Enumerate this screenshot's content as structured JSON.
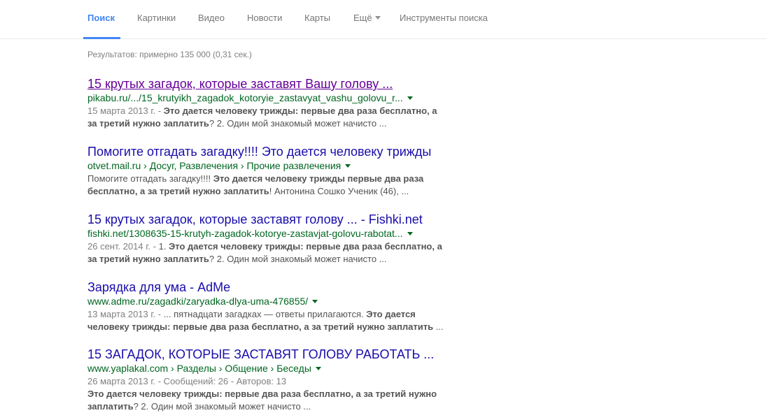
{
  "tabs": [
    {
      "label": "Поиск",
      "active": true
    },
    {
      "label": "Картинки"
    },
    {
      "label": "Видео"
    },
    {
      "label": "Новости"
    },
    {
      "label": "Карты"
    },
    {
      "label": "Ещё"
    },
    {
      "label": "Инструменты поиска"
    }
  ],
  "stats": "Результатов: примерно 135 000 (0,31 сек.) ",
  "results": [
    {
      "title": "15 крутых загадок, которые заставят Вашу голову ...",
      "visited": true,
      "url": "pikabu.ru/.../15_krutyikh_zagadok_kotoryie_zastavyat_vashu_golovu_r...",
      "line1": [
        {
          "t": "15 марта 2013 г. - ",
          "s": "date"
        },
        {
          "t": "Это дается человеку трижды: первые два раза бесплатно, а",
          "s": "b"
        }
      ],
      "line2": [
        {
          "t": "за третий нужно заплатить",
          "s": "b"
        },
        {
          "t": "? 2. Один мой знакомый может начисто ...",
          "s": ""
        }
      ]
    },
    {
      "title": "Помогите отгадать загадку!!!! Это дается человеку трижды",
      "visited": false,
      "url": "otvet.mail.ru › Досуг, Развлечения › Прочие развлечения",
      "line1": [
        {
          "t": "Помогите отгадать загадку!!!! ",
          "s": ""
        },
        {
          "t": "Это дается человеку трижды первые два раза",
          "s": "b"
        }
      ],
      "line2": [
        {
          "t": "бесплатно, а за третий нужно заплатить",
          "s": "b"
        },
        {
          "t": "! Антонина Сошко Ученик (46), ...",
          "s": ""
        }
      ]
    },
    {
      "title": "15 крутых загадок, которые заставят голову ... - Fishki.net",
      "visited": false,
      "url": "fishki.net/1308635-15-krutyh-zagadok-kotorye-zastavjat-golovu-rabotat...",
      "line1": [
        {
          "t": "26 сент. 2014 г. - ",
          "s": "date"
        },
        {
          "t": "1. ",
          "s": ""
        },
        {
          "t": "Это дается человеку трижды: первые два раза бесплатно, а",
          "s": "b"
        }
      ],
      "line2": [
        {
          "t": "за третий нужно заплатить",
          "s": "b"
        },
        {
          "t": "? 2. Один мой знакомый может начисто ...",
          "s": ""
        }
      ]
    },
    {
      "title": "Зарядка для ума - AdMe",
      "visited": false,
      "url": "www.adme.ru/zagadki/zaryadka-dlya-uma-476855/",
      "line1": [
        {
          "t": "13 марта 2013 г. - ",
          "s": "date"
        },
        {
          "t": "... пятнадцати загадках — ответы прилагаются. ",
          "s": ""
        },
        {
          "t": "Это дается",
          "s": "b"
        }
      ],
      "line2": [
        {
          "t": "человеку трижды: первые два раза бесплатно, а за третий нужно заплатить",
          "s": "b"
        },
        {
          "t": " ...",
          "s": ""
        }
      ]
    },
    {
      "title": "15 ЗАГАДОК, КОТОРЫЕ ЗАСТАВЯТ ГОЛОВУ РАБОТАТЬ ...",
      "visited": false,
      "url": "www.yaplakal.com › Разделы › Общение › Беседы",
      "line0": [
        {
          "t": "26 марта 2013 г. - Сообщений: 26 - Авторов: 13",
          "s": "date"
        }
      ],
      "line1": [
        {
          "t": "Это дается человеку трижды: первые два раза бесплатно, а за третий нужно",
          "s": "b"
        }
      ],
      "line2": [
        {
          "t": "заплатить",
          "s": "b"
        },
        {
          "t": "? 2. Один мой знакомый может начисто ...",
          "s": ""
        }
      ]
    }
  ]
}
